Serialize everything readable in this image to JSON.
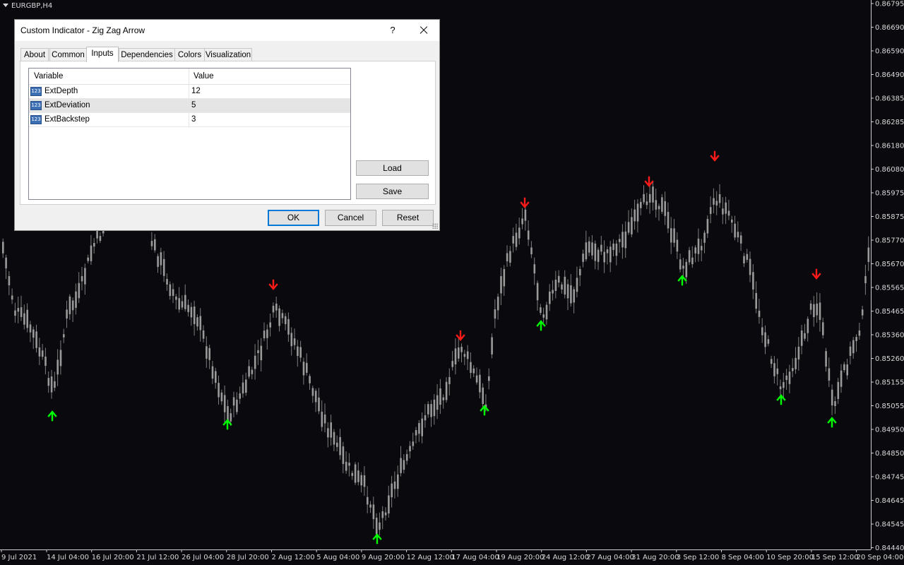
{
  "chart": {
    "symbol": "EURGBP,H4",
    "colors": {
      "background": "#0a0a0e",
      "candle": "#9a9a9a",
      "text": "#d8d8d8",
      "up_arrow": "#00ff00",
      "down_arrow": "#ff1a1a"
    },
    "price_labels": [
      "0.86795",
      "0.86690",
      "0.86590",
      "0.86490",
      "0.86385",
      "0.86285",
      "0.86180",
      "0.86080",
      "0.85975",
      "0.85875",
      "0.85770",
      "0.85670",
      "0.85565",
      "0.85465",
      "0.85360",
      "0.85260",
      "0.85155",
      "0.85055",
      "0.84950",
      "0.84850",
      "0.84745",
      "0.84645",
      "0.84545",
      "0.84440"
    ],
    "time_labels": [
      "9 Jul 2021",
      "14 Jul 04:00",
      "16 Jul 20:00",
      "21 Jul 12:00",
      "26 Jul 04:00",
      "28 Jul 20:00",
      "2 Aug 12:00",
      "5 Aug 04:00",
      "9 Aug 20:00",
      "12 Aug 12:00",
      "17 Aug 04:00",
      "19 Aug 20:00",
      "24 Aug 12:00",
      "27 Aug 04:00",
      "31 Aug 20:00",
      "3 Sep 12:00",
      "8 Sep 04:00",
      "10 Sep 20:00",
      "15 Sep 12:00",
      "20 Sep 04:00"
    ]
  },
  "dialog": {
    "title": "Custom Indicator - Zig Zag Arrow",
    "help_label": "?",
    "tabs": [
      {
        "label": "About"
      },
      {
        "label": "Common"
      },
      {
        "label": "Inputs"
      },
      {
        "label": "Dependencies"
      },
      {
        "label": "Colors"
      },
      {
        "label": "Visualization"
      }
    ],
    "active_tab": "Inputs",
    "grid": {
      "col_variable": "Variable",
      "col_value": "Value",
      "icon_text": "123",
      "rows": [
        {
          "variable": "ExtDepth",
          "value": "12"
        },
        {
          "variable": "ExtDeviation",
          "value": "5"
        },
        {
          "variable": "ExtBackstep",
          "value": "3"
        }
      ]
    },
    "buttons": {
      "load": "Load",
      "save": "Save",
      "ok": "OK",
      "cancel": "Cancel",
      "reset": "Reset"
    }
  }
}
